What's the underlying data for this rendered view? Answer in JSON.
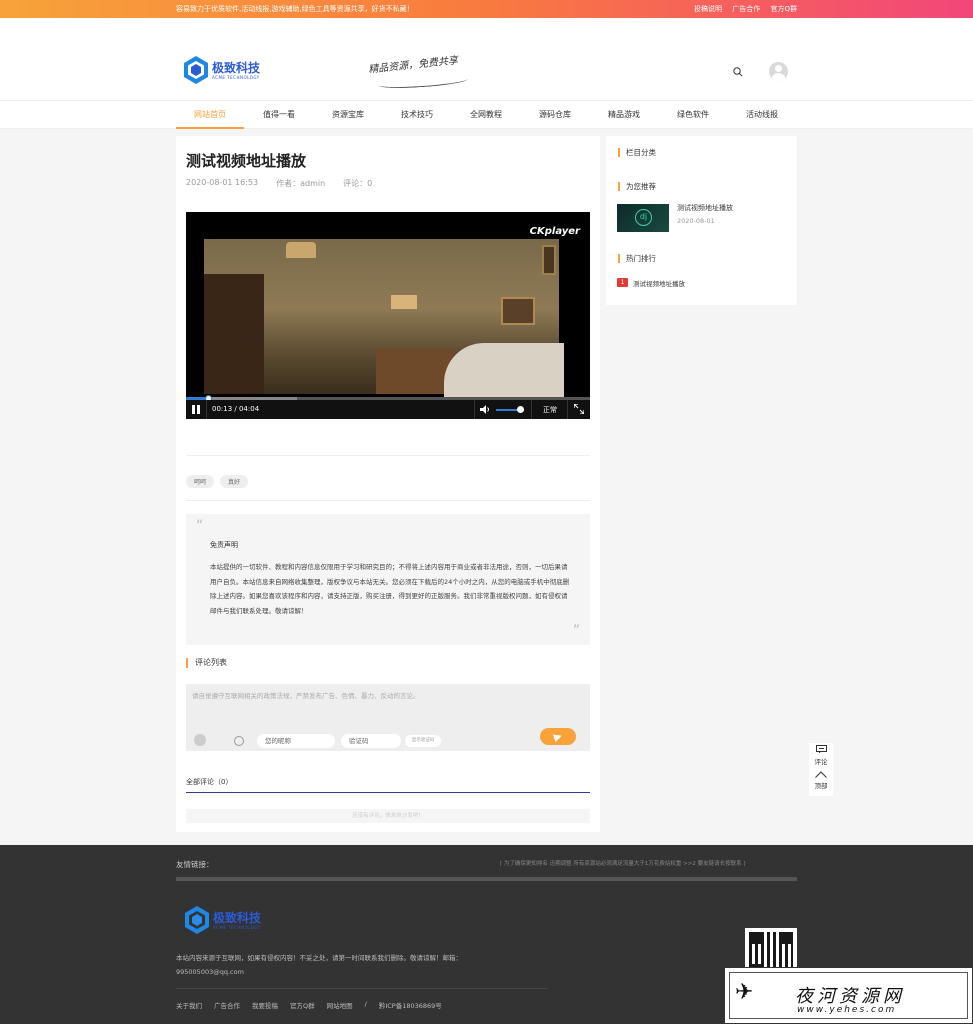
{
  "topbar": {
    "tagline": "容易致力于优质软件,活动线报,游戏辅助,绿色工具等资源共享，好货不私藏！",
    "links": [
      "投稿说明",
      "广告合作",
      "官方Q群"
    ]
  },
  "header": {
    "logo_cn": "极致科技",
    "logo_en": "ACME TECHNOLOGY",
    "slogan": "精品资源，免费共享"
  },
  "nav": {
    "items": [
      "网站首页",
      "值得一看",
      "资源宝库",
      "技术技巧",
      "全网教程",
      "源码仓库",
      "精品游戏",
      "绿色软件",
      "活动线报"
    ],
    "active_index": 0
  },
  "article": {
    "title": "测试视频地址播放",
    "date": "2020-08-01 16:53",
    "author": "作者：admin",
    "comments": "评论：0",
    "tags": [
      "呵呵",
      "真好"
    ]
  },
  "player": {
    "brand": "CKplayer",
    "time": "00:13 / 04:04",
    "quality": "正常",
    "progress": 0.054,
    "volume": 0.75
  },
  "notice": {
    "title": "免责声明",
    "body": "本站提供的一切软件、教程和内容信息仅限用于学习和研究目的；不得将上述内容用于商业或者非法用途，否则，一切后果请用户自负。本站信息来自网络收集整理，版权争议与本站无关。您必须在下载后的24个小时之内，从您的电脑或手机中彻底删除上述内容。如果您喜欢该程序和内容，请支持正版，购买注册，得到更好的正版服务。我们非常重视版权问题，如有侵权请邮件与我们联系处理。敬请谅解！"
  },
  "comments": {
    "section_title": "评论列表",
    "placeholder": "请自觉遵守互联网相关的政策法规，严禁发布广告、色情、暴力、反动的言论。",
    "nick_placeholder": "您的昵称",
    "code_placeholder": "验证码",
    "code_button": "显示验证码",
    "all_label": "全部评论（0）",
    "empty": "还没有评论，快来抢沙发吧！"
  },
  "sidebar": {
    "category_title": "栏目分类",
    "recommend_title": "为您推荐",
    "recommend_item_title": "测试视频地址播放",
    "recommend_item_date": "2020-08-01",
    "hot_title": "热门排行",
    "hot_rank": "1",
    "hot_item_title": "测试视频地址播放"
  },
  "float": {
    "comment": "评论",
    "top": "顶部"
  },
  "footer": {
    "links_label": "友情链接：",
    "scroll_notice": "[ 为了确保更知排名 迅期调整 所有资源站必须满足流量大于1万花费站权重 >>2 要友链请长按联系 ]",
    "desc": "本站内容来源于互联网，如果有侵权内容！不妥之处，请第一时间联系我们删除。敬请谅解！邮箱：995005003@qq.com",
    "nav": [
      "关于我们",
      "广告合作",
      "我要投稿",
      "官方Q群",
      "网站地图",
      "/",
      "黔ICP备18036869号"
    ]
  },
  "watermark": {
    "cn": "夜河资源网",
    "url": "www.yehes.com"
  },
  "colors": {
    "accent": "#f7a33a",
    "brand": "#2b5bd8",
    "player_progress": "#2f7bd8"
  }
}
